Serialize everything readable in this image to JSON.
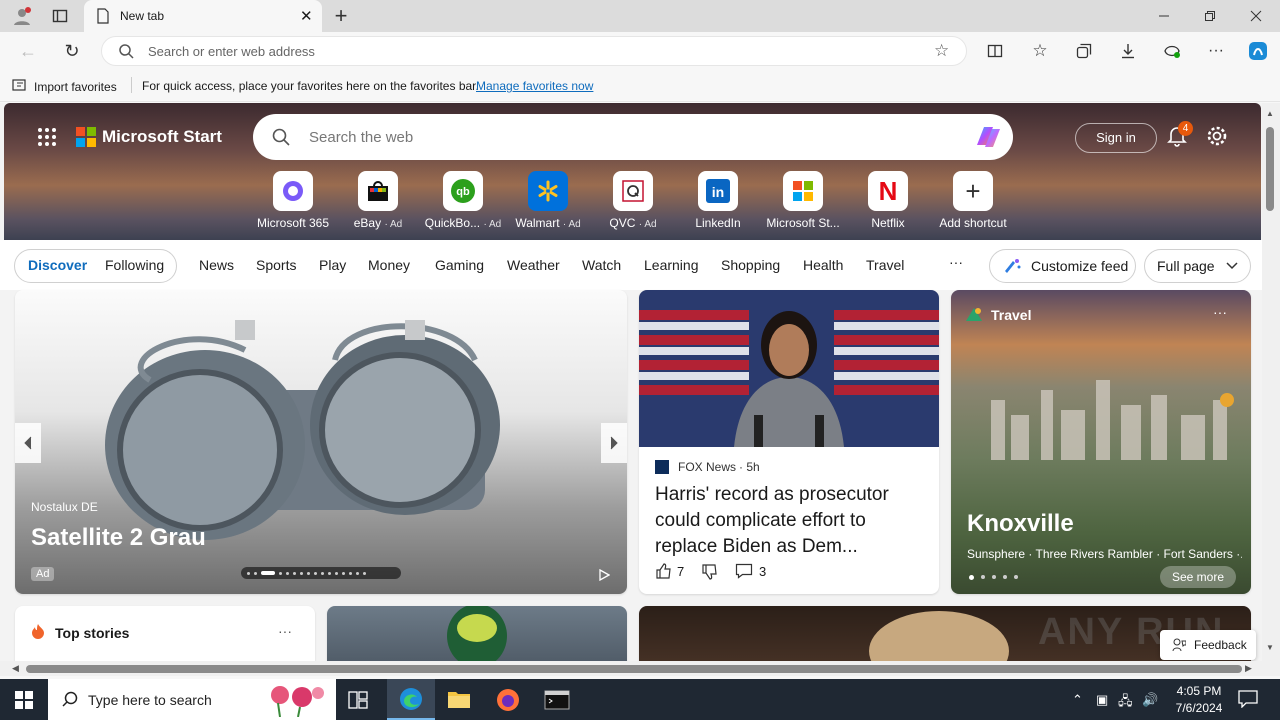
{
  "browser": {
    "tab_title": "New tab",
    "address_placeholder": "Search or enter web address",
    "favbar": {
      "import_label": "Import favorites",
      "hint": "For quick access, place your favorites here on the favorites bar.",
      "manage_link": "Manage favorites now"
    }
  },
  "start": {
    "logo_text": "Microsoft Start",
    "search_placeholder": "Search the web",
    "signin_label": "Sign in",
    "notification_count": "4",
    "shortcuts": [
      {
        "label": "Microsoft 365",
        "ad": "",
        "icon": "m365-icon"
      },
      {
        "label": "eBay",
        "ad": "· Ad",
        "icon": "ebay-icon"
      },
      {
        "label": "QuickBo...",
        "ad": "· Ad",
        "icon": "quickbooks-icon"
      },
      {
        "label": "Walmart",
        "ad": "· Ad",
        "icon": "walmart-icon"
      },
      {
        "label": "QVC",
        "ad": "· Ad",
        "icon": "qvc-icon"
      },
      {
        "label": "LinkedIn",
        "ad": "",
        "icon": "linkedin-icon"
      },
      {
        "label": "Microsoft St...",
        "ad": "",
        "icon": "msstore-icon"
      },
      {
        "label": "Netflix",
        "ad": "",
        "icon": "netflix-icon"
      },
      {
        "label": "Add shortcut",
        "ad": "",
        "icon": "plus-icon"
      }
    ],
    "tabs": {
      "discover": "Discover",
      "following": "Following"
    },
    "nav": [
      "News",
      "Sports",
      "Play",
      "Money",
      "Gaming",
      "Weather",
      "Watch",
      "Learning",
      "Shopping",
      "Health",
      "Travel"
    ],
    "more": "···",
    "customize_label": "Customize feed",
    "layout_label": "Full page"
  },
  "ad_card": {
    "brand": "Nostalux DE",
    "title": "Satellite 2 Grau",
    "badge": "Ad"
  },
  "news_card": {
    "source": "FOX News",
    "time": "· 5h",
    "headline": "Harris' record as prosecutor could complicate effort to replace Biden as Dem...",
    "likes": "7",
    "comments": "3"
  },
  "travel_card": {
    "category": "Travel",
    "city": "Knoxville",
    "places": "Sunsphere · Three Rivers Rambler · Fort Sanders ·...",
    "see_more": "See more"
  },
  "top_stories": {
    "title": "Top stories",
    "more": "···"
  },
  "feedback": "Feedback",
  "watermark": "ANY RUN",
  "taskbar": {
    "search_placeholder": "Type here to search",
    "time": "4:05 PM",
    "date": "7/6/2024"
  },
  "colors": {
    "accent": "#0f6cbd",
    "taskbar": "#1f2833"
  }
}
